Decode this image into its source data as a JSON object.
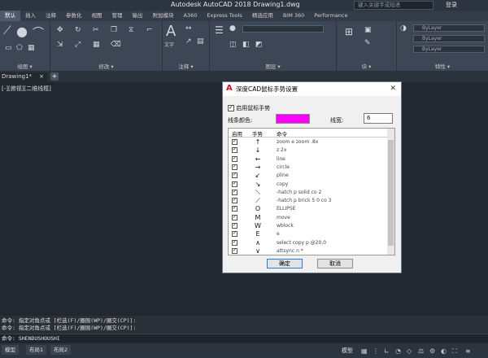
{
  "titlebar": {
    "title": "Autodesk AutoCAD 2018   Drawing1.dwg",
    "search_placeholder": "键入关键字或短语",
    "login": "登录"
  },
  "menubar": {
    "tabs": [
      "默认",
      "插入",
      "注释",
      "参数化",
      "视图",
      "管理",
      "输出",
      "附加模块",
      "A360",
      "Express Tools",
      "精选应用",
      "BIM 360",
      "Performance"
    ]
  },
  "ribbon": {
    "panels": [
      {
        "label": "绘图 ▾"
      },
      {
        "label": "修改 ▾"
      },
      {
        "label": "注释 ▾"
      },
      {
        "label": "图层 ▾"
      },
      {
        "label": "块 ▾"
      },
      {
        "label": "特性 ▾"
      }
    ],
    "bylayer": [
      "ByLayer",
      "ByLayer",
      "ByLayer"
    ],
    "text_label": "文字"
  },
  "filetab": {
    "name": "Drawing1*",
    "close": "×",
    "add": "+"
  },
  "viewport": {
    "label": "[-][俯视][二维线框]"
  },
  "dialog": {
    "title": "深度CAD鼠标手势设置",
    "close": "✕",
    "enable_label": "启用鼠标手势",
    "enabled": true,
    "color_label": "线条颜色:",
    "line_color": "#ff00ff",
    "width_label": "线宽:",
    "width_value": "6",
    "columns": [
      "启用",
      "手势",
      "命令"
    ],
    "rows": [
      {
        "enabled": true,
        "gesture": "↑",
        "command": "zoom e zoom .8x"
      },
      {
        "enabled": true,
        "gesture": "↓",
        "command": "z 2x"
      },
      {
        "enabled": true,
        "gesture": "←",
        "command": "line"
      },
      {
        "enabled": true,
        "gesture": "→",
        "command": "circle"
      },
      {
        "enabled": true,
        "gesture": "↙",
        "command": "pline"
      },
      {
        "enabled": true,
        "gesture": "↘",
        "command": "copy"
      },
      {
        "enabled": true,
        "gesture": "⟍",
        "command": "-hatch p solid co 2"
      },
      {
        "enabled": true,
        "gesture": "⟋",
        "command": "-hatch p brick 5 0 co 3"
      },
      {
        "enabled": true,
        "gesture": "O",
        "command": "ELLIPSE"
      },
      {
        "enabled": true,
        "gesture": "M",
        "command": "move"
      },
      {
        "enabled": true,
        "gesture": "W",
        "command": "wblock"
      },
      {
        "enabled": true,
        "gesture": "E",
        "command": "e"
      },
      {
        "enabled": true,
        "gesture": "∧",
        "command": "select copy p @20,0"
      },
      {
        "enabled": true,
        "gesture": "∨",
        "command": "attsync n *"
      }
    ],
    "ok": "确定",
    "cancel": "取消"
  },
  "command": {
    "history": [
      "命令: 指定对角点或 [栏选(F)/圈围(WP)/圈交(CP)]:",
      "命令: 指定对角点或 [栏选(F)/圈围(WP)/圈交(CP)]:"
    ],
    "input": "命令: SHENDUSHOUSHI"
  },
  "status": {
    "layout_tabs": [
      "模型",
      "布局1",
      "布局2"
    ],
    "model": "模型"
  }
}
